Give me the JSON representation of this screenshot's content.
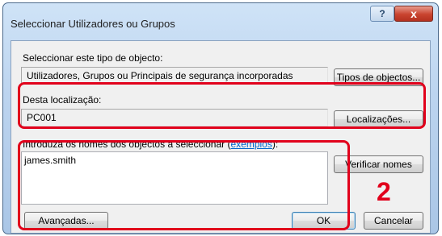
{
  "window": {
    "title": "Seleccionar Utilizadores ou Grupos",
    "help_glyph": "?",
    "close_glyph": "x"
  },
  "object_type": {
    "label": "Seleccionar este tipo de objecto:",
    "value": "Utilizadores, Grupos ou Principais de segurança incorporadas",
    "button_label": "Tipos de objectos..."
  },
  "location": {
    "label": "Desta localização:",
    "value": "PC001",
    "button_label": "Localizações..."
  },
  "names": {
    "label_prefix": "Introduza os nomes dos objectos a seleccionar (",
    "label_link": "exemplos",
    "label_suffix": "):",
    "value": "james.smith",
    "check_button_label": "Verificar nomes"
  },
  "footer": {
    "advanced_label": "Avançadas...",
    "ok_label": "OK",
    "cancel_label": "Cancelar"
  },
  "annotation": {
    "step_number": "2",
    "highlight_color": "#e1001b"
  }
}
